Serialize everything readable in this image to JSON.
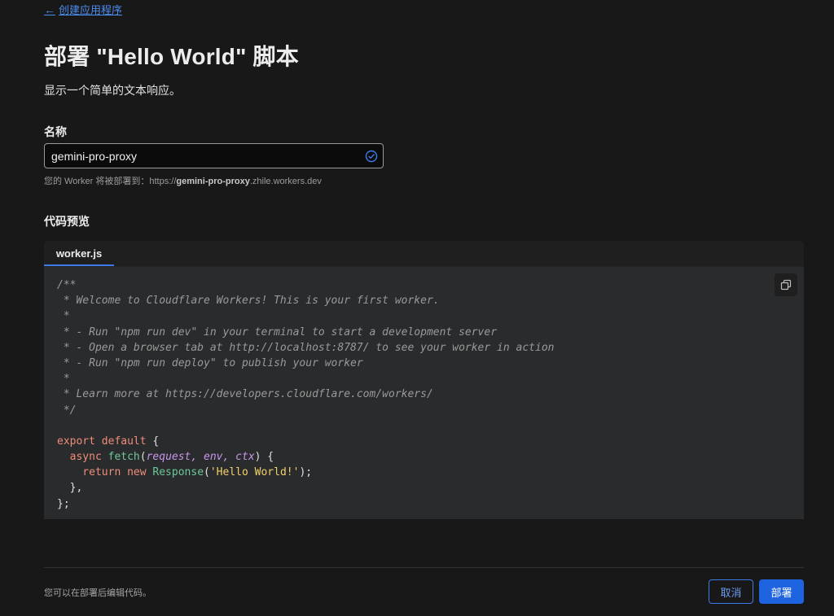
{
  "nav": {
    "back_label": "创建应用程序"
  },
  "header": {
    "title": "部署 \"Hello World\" 脚本",
    "description": "显示一个简单的文本响应。"
  },
  "form": {
    "name_label": "名称",
    "name_value": "gemini-pro-proxy",
    "name_valid": true,
    "hint_prefix": "您的 Worker 将被部署到：https://",
    "hint_name": "gemini-pro-proxy",
    "hint_suffix": ".zhile.workers.dev"
  },
  "preview": {
    "label": "代码预览",
    "tab_label": "worker.js",
    "copy_icon": "copy-icon",
    "code_lines": [
      [
        {
          "t": "c-com",
          "v": "/**"
        }
      ],
      [
        {
          "t": "c-com",
          "v": " * Welcome to Cloudflare Workers! This is your first worker."
        }
      ],
      [
        {
          "t": "c-com",
          "v": " *"
        }
      ],
      [
        {
          "t": "c-com",
          "v": " * - Run \"npm run dev\" in your terminal to start a development server"
        }
      ],
      [
        {
          "t": "c-com",
          "v": " * - Open a browser tab at http://localhost:8787/ to see your worker in action"
        }
      ],
      [
        {
          "t": "c-com",
          "v": " * - Run \"npm run deploy\" to publish your worker"
        }
      ],
      [
        {
          "t": "c-com",
          "v": " *"
        }
      ],
      [
        {
          "t": "c-com",
          "v": " * Learn more at https://developers.cloudflare.com/workers/"
        }
      ],
      [
        {
          "t": "c-com",
          "v": " */"
        }
      ],
      [],
      [
        {
          "t": "c-kw",
          "v": "export default"
        },
        {
          "t": "c-txt",
          "v": " {"
        }
      ],
      [
        {
          "t": "c-kw",
          "v": "  async"
        },
        {
          "t": "c-txt",
          "v": " "
        },
        {
          "t": "c-fn",
          "v": "fetch"
        },
        {
          "t": "c-txt",
          "v": "("
        },
        {
          "t": "c-param",
          "v": "request, env, ctx"
        },
        {
          "t": "c-txt",
          "v": ") {"
        }
      ],
      [
        {
          "t": "c-kw",
          "v": "    return new"
        },
        {
          "t": "c-txt",
          "v": " "
        },
        {
          "t": "c-fn",
          "v": "Response"
        },
        {
          "t": "c-txt",
          "v": "("
        },
        {
          "t": "c-str",
          "v": "'Hello World!'"
        },
        {
          "t": "c-txt",
          "v": ");"
        }
      ],
      [
        {
          "t": "c-txt",
          "v": "  },"
        }
      ],
      [
        {
          "t": "c-txt",
          "v": "};"
        }
      ]
    ]
  },
  "footer": {
    "note": "您可以在部署后编辑代码。",
    "cancel_label": "取消",
    "deploy_label": "部署"
  },
  "colors": {
    "accent": "#1e63df",
    "link": "#4d8cf0",
    "background": "#181818",
    "code_background": "#2a2b2d"
  }
}
